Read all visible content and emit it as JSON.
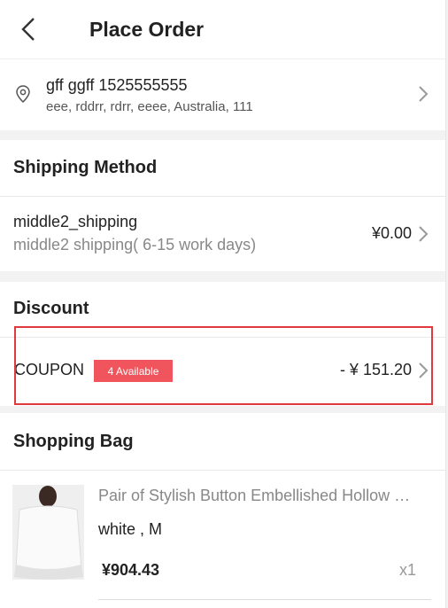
{
  "header": {
    "title": "Place Order"
  },
  "address": {
    "name_phone": "gff ggff 1525555555",
    "line": "eee, rddrr, rdrr, eeee, Australia, 111"
  },
  "shipping": {
    "section_title": "Shipping Method",
    "name": "middle2_shipping",
    "description": "middle2 shipping( 6-15 work days)",
    "price": "¥0.00"
  },
  "discount": {
    "section_title": "Discount",
    "coupon_label": "COUPON",
    "badge": "4 Available",
    "amount": "- ¥ 151.20"
  },
  "bag": {
    "section_title": "Shopping Bag",
    "item": {
      "name": "Pair of Stylish Button Embellished Hollow Out Lace Blouse",
      "variant": "white , M",
      "price": "¥904.43",
      "qty": "x1"
    }
  },
  "colors": {
    "accent": "#f0545c",
    "highlight": "#e0393e"
  }
}
